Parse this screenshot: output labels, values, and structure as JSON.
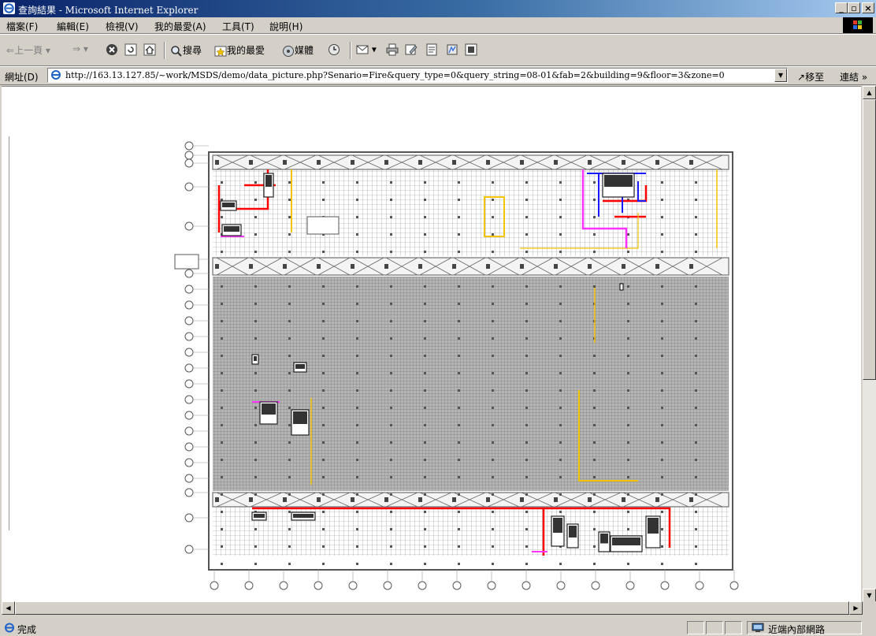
{
  "window": {
    "title": "查詢結果 - Microsoft Internet Explorer",
    "minimize": "_",
    "maximize": "▫",
    "close": "×"
  },
  "menu": {
    "items": [
      "檔案(F)",
      "編輯(E)",
      "檢視(V)",
      "我的最愛(A)",
      "工具(T)",
      "說明(H)"
    ]
  },
  "toolbar": {
    "back": "上一頁",
    "search": "搜尋",
    "favorites": "我的最愛",
    "media": "媒體"
  },
  "address": {
    "label": "網址(D)",
    "url": "http://163.13.127.85/~work/MSDS/demo/data_picture.php?Senario=Fire&query_type=0&query_string=08-01&fab=2&building=9&floor=3&zone=0",
    "go": "移至",
    "links": "連結 »"
  },
  "status": {
    "text": "完成",
    "zone": "近端內部網路"
  },
  "colors": {
    "title_start": "#0a246a",
    "title_end": "#a6caf0",
    "chrome": "#d4d0c8",
    "pipe_red": "#ff0000",
    "pipe_yellow": "#f5c400",
    "pipe_magenta": "#ff33ff",
    "pipe_blue": "#1a1aff",
    "grid_gray": "#8a8a8a"
  }
}
